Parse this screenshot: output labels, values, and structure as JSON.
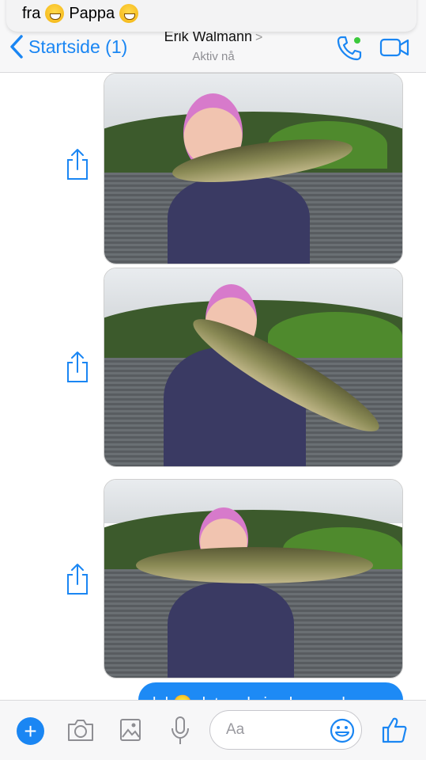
{
  "notification": {
    "text_before": "fra",
    "text_after": "Pappa"
  },
  "header": {
    "back_label": "Startside (1)",
    "contact_name": "Erik Walmann",
    "contact_status": "Aktiv nå",
    "accent_color": "#1a86f3"
  },
  "messages": {
    "outgoing_partial": "lol 🙂 det er de jeg har sv den"
  },
  "composer": {
    "placeholder": "Aa"
  },
  "icons": [
    "back-chevron-icon",
    "phone-icon",
    "video-icon",
    "share-icon",
    "plus-icon",
    "camera-icon",
    "gallery-icon",
    "microphone-icon",
    "emoji-icon",
    "thumbs-up-icon"
  ]
}
